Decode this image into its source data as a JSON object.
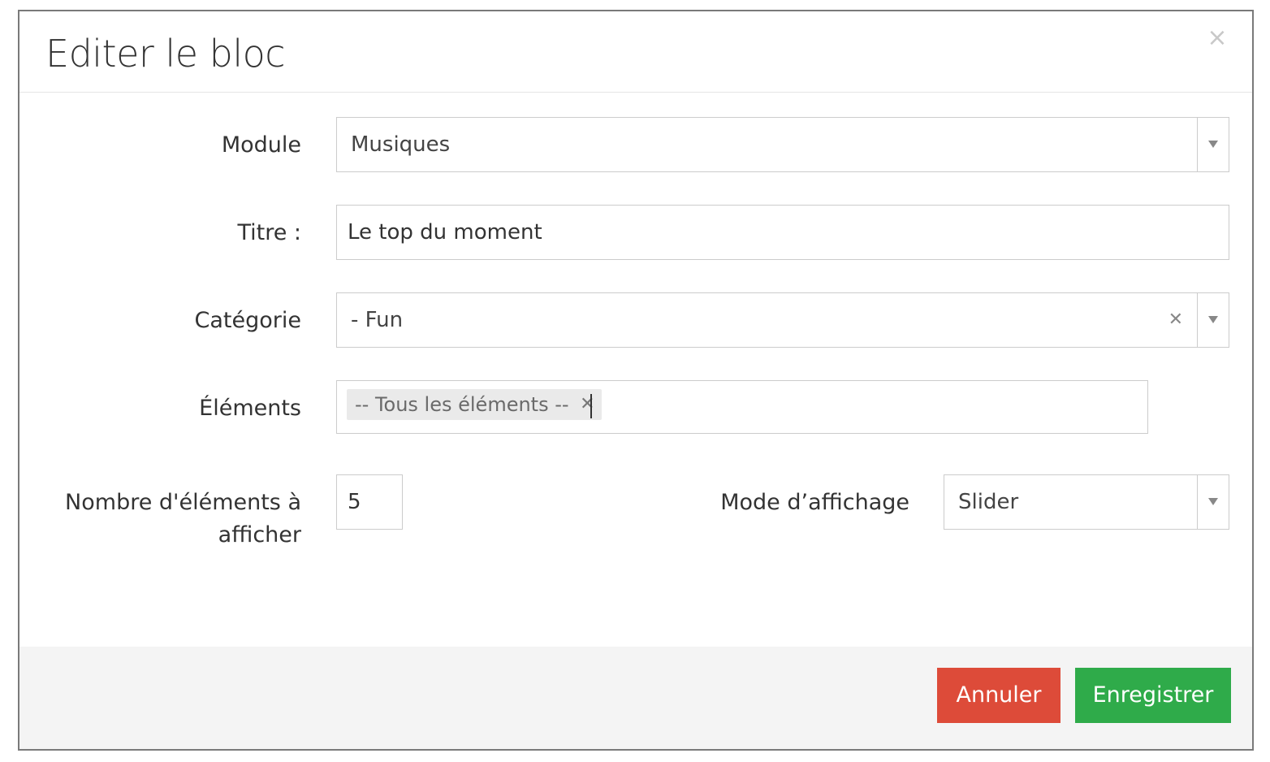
{
  "modal": {
    "title": "Editer le bloc",
    "close_icon": "close-icon"
  },
  "form": {
    "module": {
      "label": "Module",
      "value": "Musiques"
    },
    "titre": {
      "label": "Titre :",
      "value": "Le top du moment"
    },
    "categorie": {
      "label": "Catégorie",
      "value": "- Fun"
    },
    "elements": {
      "label": "Éléments",
      "tags": [
        "-- Tous les éléments --"
      ]
    },
    "nombre": {
      "label_line1": "Nombre d'éléments à",
      "label_line2": "afficher",
      "value": "5"
    },
    "mode": {
      "label": "Mode d’affichage",
      "value": "Slider"
    }
  },
  "footer": {
    "cancel_label": "Annuler",
    "save_label": "Enregistrer"
  },
  "colors": {
    "cancel": "#dd4b39",
    "save": "#2fab4a",
    "footer_bg": "#f4f4f4"
  }
}
